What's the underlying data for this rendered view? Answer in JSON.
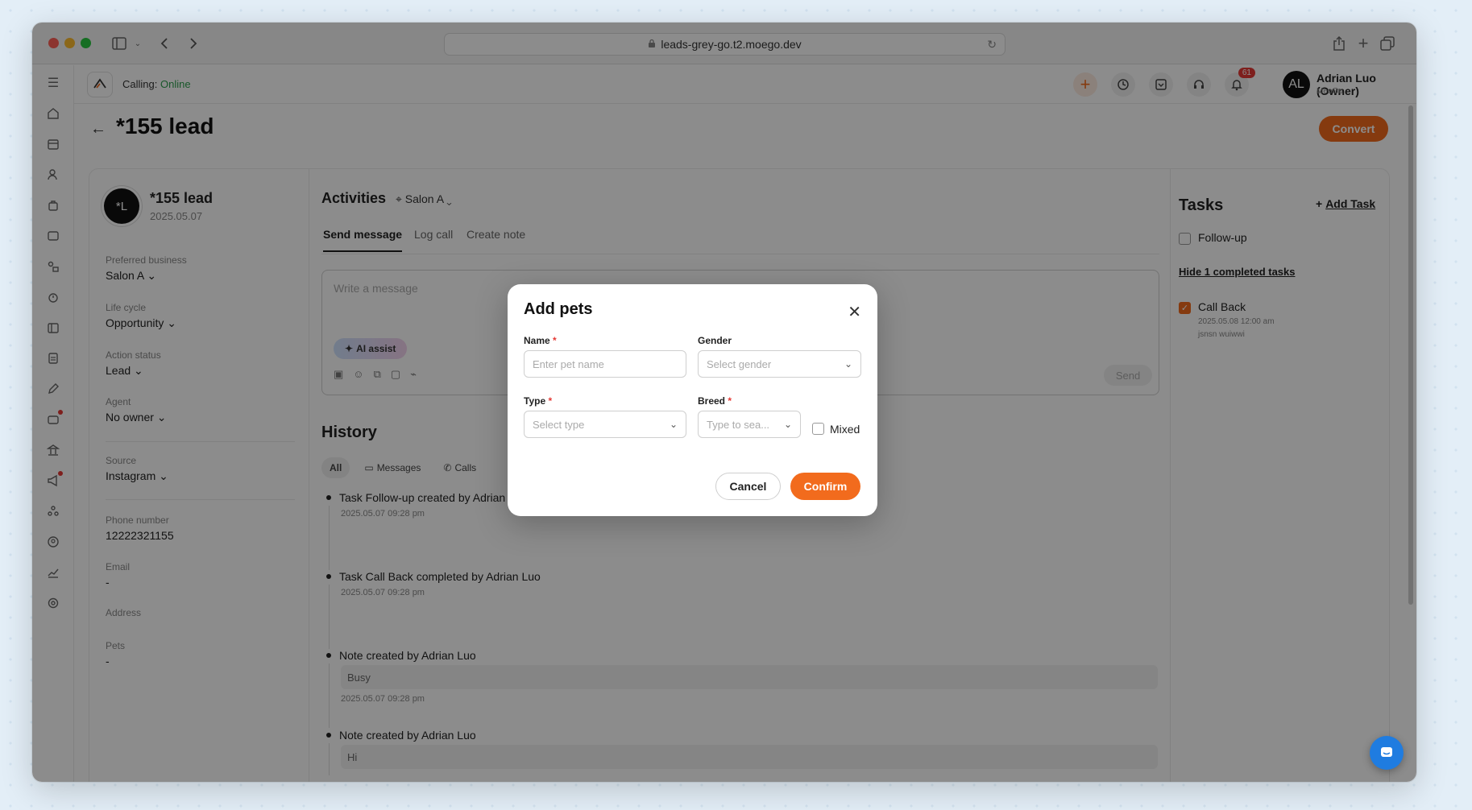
{
  "browser": {
    "url": "leads-grey-go.t2.moego.dev"
  },
  "topbar": {
    "calling_label": "Calling:",
    "calling_status": "Online",
    "notification_count": "61",
    "user_initials": "AL",
    "user_name": "Adrian Luo (Owner)",
    "user_business": "MeoGo"
  },
  "page": {
    "title": "*155 lead",
    "convert_label": "Convert"
  },
  "lead": {
    "initials": "*L",
    "name": "*155 lead",
    "created": "2025.05.07",
    "fields": [
      {
        "label": "Preferred business",
        "value": "Salon A"
      },
      {
        "label": "Life cycle",
        "value": "Opportunity"
      },
      {
        "label": "Action status",
        "value": "Lead"
      },
      {
        "label": "Agent",
        "value": "No owner"
      },
      {
        "label": "Source",
        "value": "Instagram"
      },
      {
        "label": "Phone number",
        "value": "12222321155"
      },
      {
        "label": "Email",
        "value": "-"
      },
      {
        "label": "Address",
        "value": ""
      },
      {
        "label": "Pets",
        "value": "-"
      }
    ]
  },
  "activities": {
    "title": "Activities",
    "location": "Salon A",
    "tabs": [
      "Send message",
      "Log call",
      "Create note"
    ],
    "message_placeholder": "Write a message",
    "ai_assist_label": "AI assist",
    "send_label": "Send"
  },
  "history": {
    "title": "History",
    "filters": [
      "All",
      "Messages",
      "Calls"
    ],
    "items": [
      {
        "text": "Task Follow-up created by Adrian Luo",
        "time": "2025.05.07 09:28 pm",
        "note": ""
      },
      {
        "text": "Task Call Back completed by Adrian Luo",
        "time": "2025.05.07 09:28 pm",
        "note": ""
      },
      {
        "text": "Note created by Adrian Luo",
        "time": "2025.05.07 09:28 pm",
        "note": "Busy"
      },
      {
        "text": "Note created by Adrian Luo",
        "time": "",
        "note": "Hi"
      }
    ]
  },
  "tasks": {
    "title": "Tasks",
    "add_label": "Add Task",
    "open": [
      {
        "label": "Follow-up"
      }
    ],
    "hide_completed_label": "Hide 1 completed tasks",
    "completed": [
      {
        "label": "Call Back",
        "due": "2025.05.08 12:00 am",
        "note": "jsnsn wuiwwi"
      }
    ]
  },
  "modal": {
    "title": "Add pets",
    "name_label": "Name",
    "name_placeholder": "Enter pet name",
    "gender_label": "Gender",
    "gender_placeholder": "Select gender",
    "type_label": "Type",
    "type_placeholder": "Select type",
    "breed_label": "Breed",
    "breed_placeholder": "Type to sea...",
    "mixed_label": "Mixed",
    "required_mark": "*",
    "cancel_label": "Cancel",
    "confirm_label": "Confirm"
  },
  "colors": {
    "accent": "#f26b1d",
    "online": "#2e9e4e"
  }
}
